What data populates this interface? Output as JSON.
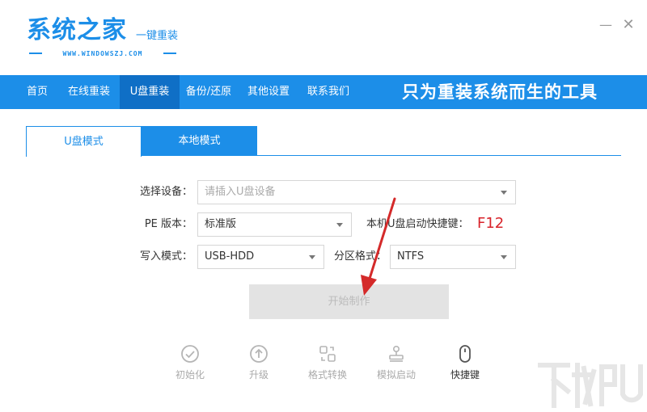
{
  "window": {
    "min_symbol": "—",
    "close_symbol": "✕"
  },
  "brand": {
    "title": "系统之家",
    "subtitle": "一键重装",
    "url": "WWW.WINDOWSZJ.COM"
  },
  "nav": {
    "items": [
      {
        "label": "首页"
      },
      {
        "label": "在线重装"
      },
      {
        "label": "U盘重装"
      },
      {
        "label": "备份/还原"
      },
      {
        "label": "其他设置"
      },
      {
        "label": "联系我们"
      }
    ],
    "active_index": 2,
    "slogan": "只为重装系统而生的工具"
  },
  "tabs": [
    {
      "label": "U盘模式"
    },
    {
      "label": "本地模式"
    }
  ],
  "form": {
    "device_label": "选择设备：",
    "device_placeholder": "请插入U盘设备",
    "pe_label": "PE 版本：",
    "pe_value": "标准版",
    "hotkey_label": "本机U盘启动快捷键：",
    "hotkey_value": "F12",
    "write_label": "写入模式：",
    "write_value": "USB-HDD",
    "partition_label": "分区格式：",
    "partition_value": "NTFS",
    "start_label": "开始制作"
  },
  "tools": [
    {
      "label": "初始化",
      "icon": "check-circle-icon"
    },
    {
      "label": "升级",
      "icon": "upload-circle-icon"
    },
    {
      "label": "格式转换",
      "icon": "convert-icon"
    },
    {
      "label": "模拟启动",
      "icon": "stamp-icon"
    },
    {
      "label": "快捷键",
      "icon": "mouse-icon"
    }
  ],
  "colors": {
    "brand_blue": "#1c8ee8",
    "nav_active": "#0f6fc6",
    "hotkey_red": "#d8232a",
    "annotation_red": "#d42a2a"
  }
}
